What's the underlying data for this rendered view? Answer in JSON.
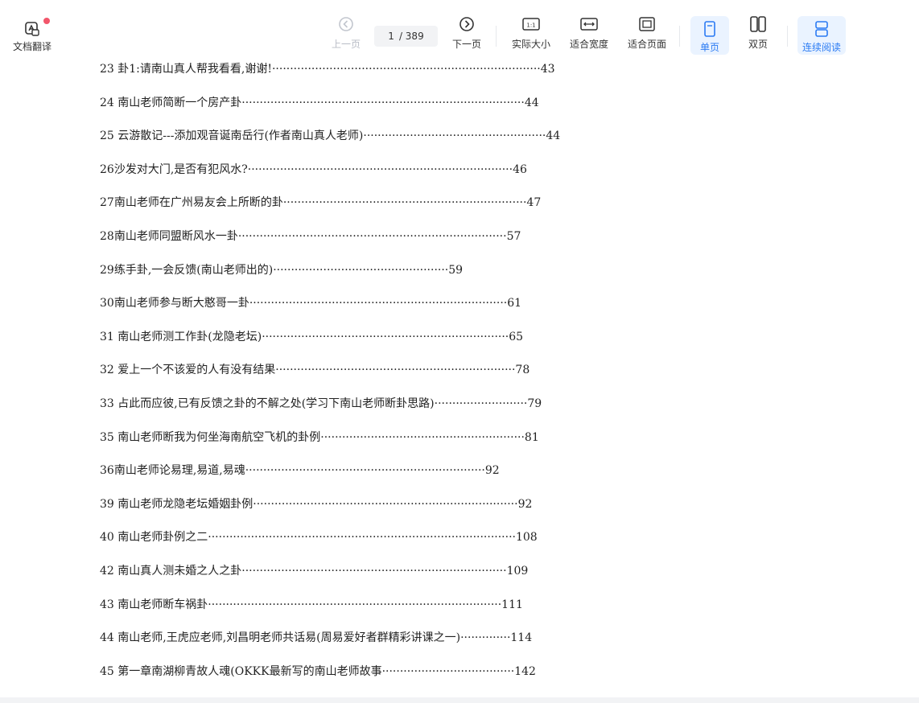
{
  "toolbar": {
    "translate_label": "文档翻译",
    "prev_label": "上一页",
    "next_label": "下一页",
    "page_current": "1",
    "page_total": "/ 389",
    "actual_size_label": "实际大小",
    "actual_size_glyph": "1:1",
    "fit_width_label": "适合宽度",
    "fit_page_label": "适合页面",
    "single_label": "单页",
    "double_label": "双页",
    "continuous_label": "连续阅读"
  },
  "toc": [
    {
      "text": "23 卦1:请南山真人帮我看看,谢谢!···········································································43"
    },
    {
      "text": "24 南山老师简断一个房产卦···············································································44"
    },
    {
      "text": "25 云游散记---添加观音诞南岳行(作者南山真人老师)···················································44"
    },
    {
      "text": "26沙发对大门,是否有犯风水?··········································································46"
    },
    {
      "text": "27南山老师在广州易友会上所断的卦····································································47"
    },
    {
      "text": "28南山老师同盟断风水一卦···········································································57"
    },
    {
      "text": "29练手卦,一会反馈(南山老师出的)·················································59"
    },
    {
      "text": "30南山老师参与断大憨哥一卦········································································61"
    },
    {
      "text": "31 南山老师测工作卦(龙隐老坛)·····································································65"
    },
    {
      "text": "32 爱上一个不该爱的人有没有结果···································································78"
    },
    {
      "text": "33 占此而应彼,已有反馈之卦的不解之处(学习下南山老师断卦思路)··························79"
    },
    {
      "text": "35 南山老师断我为何坐海南航空飞机的卦例·························································81"
    },
    {
      "text": "36南山老师论易理,易道,易魂···································································92"
    },
    {
      "text": "39 南山老师龙隐老坛婚姻卦例··········································································92"
    },
    {
      "text": "40 南山老师卦例之二······················································································108"
    },
    {
      "text": "42 南山真人测未婚之人之卦··········································································109"
    },
    {
      "text": "43 南山老师断车祸卦··················································································111"
    },
    {
      "text": "44 南山老师,王虎应老师,刘昌明老师共话易(周易爱好者群精彩讲课之一)··············114"
    },
    {
      "text": "45 第一章南湖柳青故人魂(OKKK最新写的南山老师故事·····································142"
    }
  ]
}
